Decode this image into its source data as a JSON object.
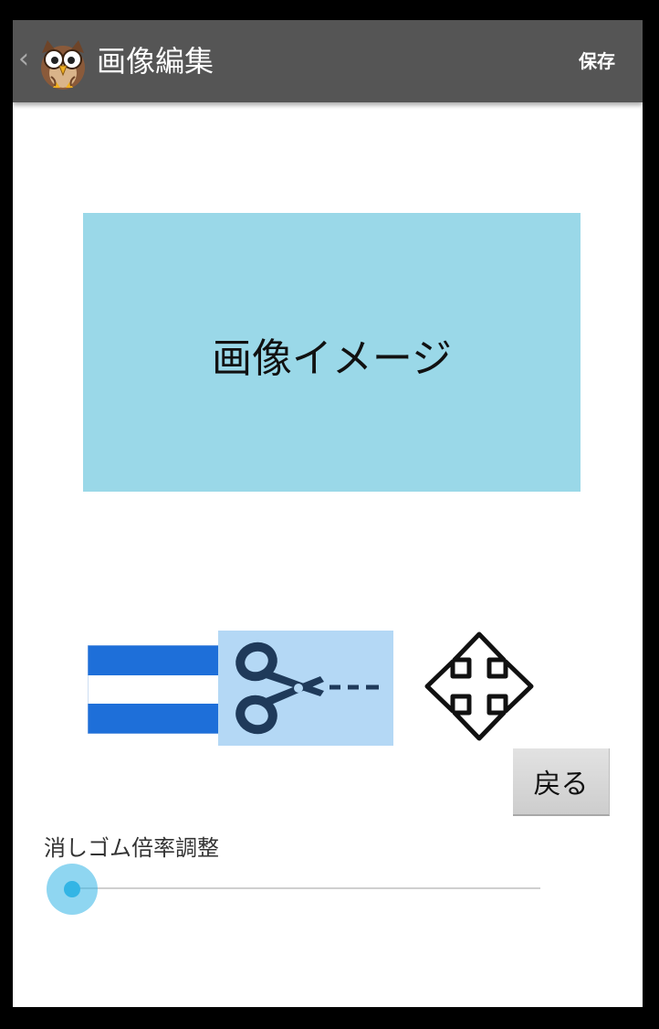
{
  "actionbar": {
    "title": "画像編集",
    "save_label": "保存",
    "up_icon": "chevron-left-icon",
    "app_icon": "owl-logo"
  },
  "main": {
    "image_placeholder": "画像イメージ"
  },
  "tools": {
    "menu_icon": "menu-icon",
    "cut_icon": "scissors-icon",
    "move_icon": "move-arrows-icon",
    "selected": "cut"
  },
  "back_label": "戻る",
  "eraser": {
    "label": "消しゴム倍率調整",
    "value": 0
  },
  "colors": {
    "actionbar": "#555555",
    "image_area": "#9ad8e8",
    "menu_blue": "#1e6fd9",
    "cut_highlight": "#b4d8f5",
    "scissors": "#1f3a5a",
    "slider_accent": "#33b5e5"
  }
}
